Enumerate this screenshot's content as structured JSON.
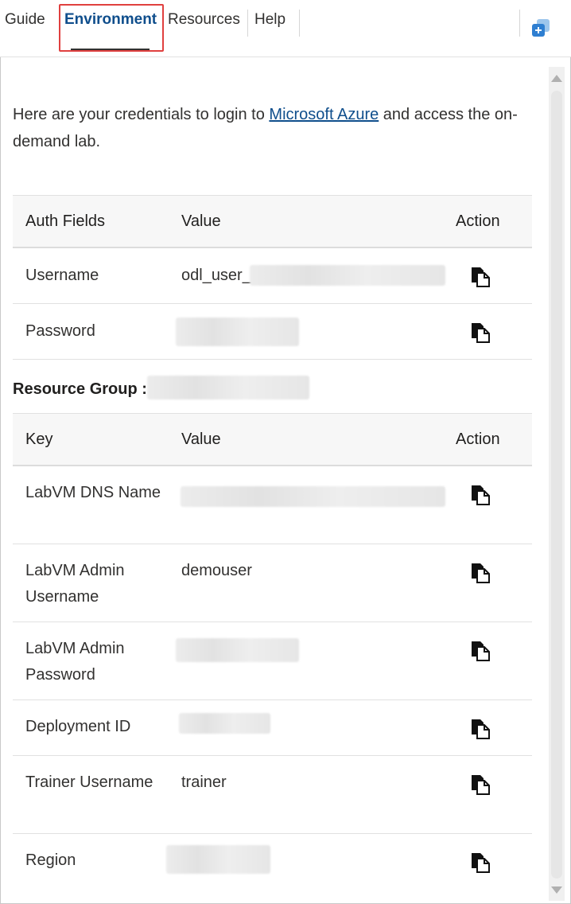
{
  "tabs": [
    {
      "label": "Guide",
      "active": false
    },
    {
      "label": "Environment",
      "active": true
    },
    {
      "label": "Resources",
      "active": false
    },
    {
      "label": "Help",
      "active": false
    }
  ],
  "toolbar": {
    "icon": "add-window-icon"
  },
  "intro": {
    "before": "Here are your credentials to login to ",
    "link": "Microsoft Azure",
    "after": " and access the on-demand lab."
  },
  "auth_table": {
    "headers": [
      "Auth Fields",
      "Value",
      "Action"
    ],
    "rows": [
      {
        "field": "Username",
        "value": "odl_user_"
      },
      {
        "field": "Password",
        "value": ""
      }
    ]
  },
  "resource_group": {
    "label": "Resource Group :",
    "value": ""
  },
  "key_table": {
    "headers": [
      "Key",
      "Value",
      "Action"
    ],
    "rows": [
      {
        "key": "LabVM DNS Name",
        "value": ""
      },
      {
        "key": "LabVM Admin Username",
        "value": "demouser"
      },
      {
        "key": "LabVM Admin Password",
        "value": ""
      },
      {
        "key": "Deployment ID",
        "value": ""
      },
      {
        "key": "Trainer Username",
        "value": "trainer"
      },
      {
        "key": "Region",
        "value": ""
      }
    ]
  },
  "icons": {
    "copy": "copy-icon"
  },
  "colors": {
    "link": "#0f4e8c",
    "highlight": "#e0403f",
    "active_tab": "#0f4e8c"
  }
}
